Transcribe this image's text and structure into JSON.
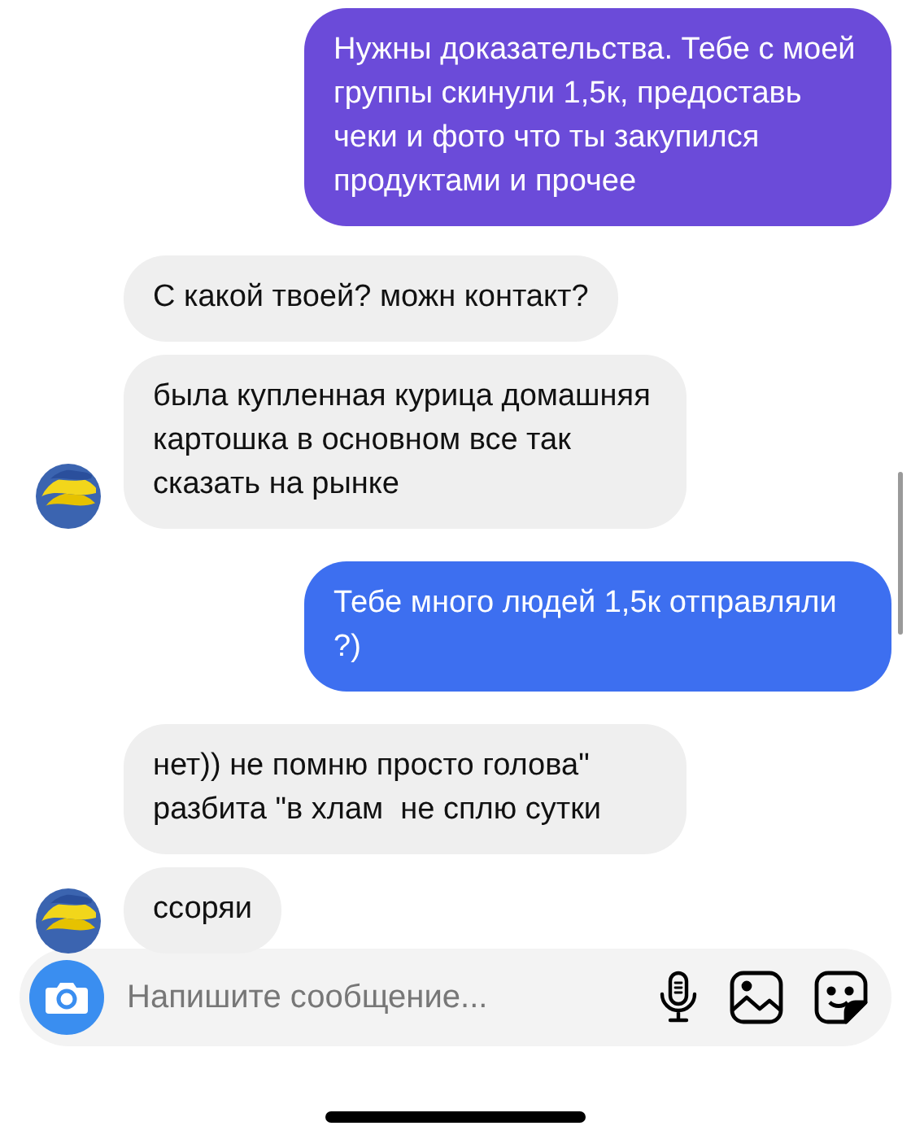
{
  "messages": [
    {
      "kind": "sent",
      "color": "#6b4bd9",
      "text": "Нужны доказательства. Тебе с моей группы скинули 1,5к, предоставь чеки и фото что ты закупился продуктами и прочее"
    },
    {
      "kind": "received",
      "text": "С какой твоей? можн контакт?"
    },
    {
      "kind": "received",
      "text": "была купленная курица домашняя картошка в основном все так сказать на рынке"
    },
    {
      "kind": "sent",
      "color": "#3d6ff0",
      "text": "Тебе много людей 1,5к отправляли ?)"
    },
    {
      "kind": "received",
      "text": "нет)) не помню просто голова\" разбита \"в хлам  не сплю сутки"
    },
    {
      "kind": "received",
      "text": "ссоряи"
    }
  ],
  "composer": {
    "placeholder": "Напишите сообщение..."
  }
}
